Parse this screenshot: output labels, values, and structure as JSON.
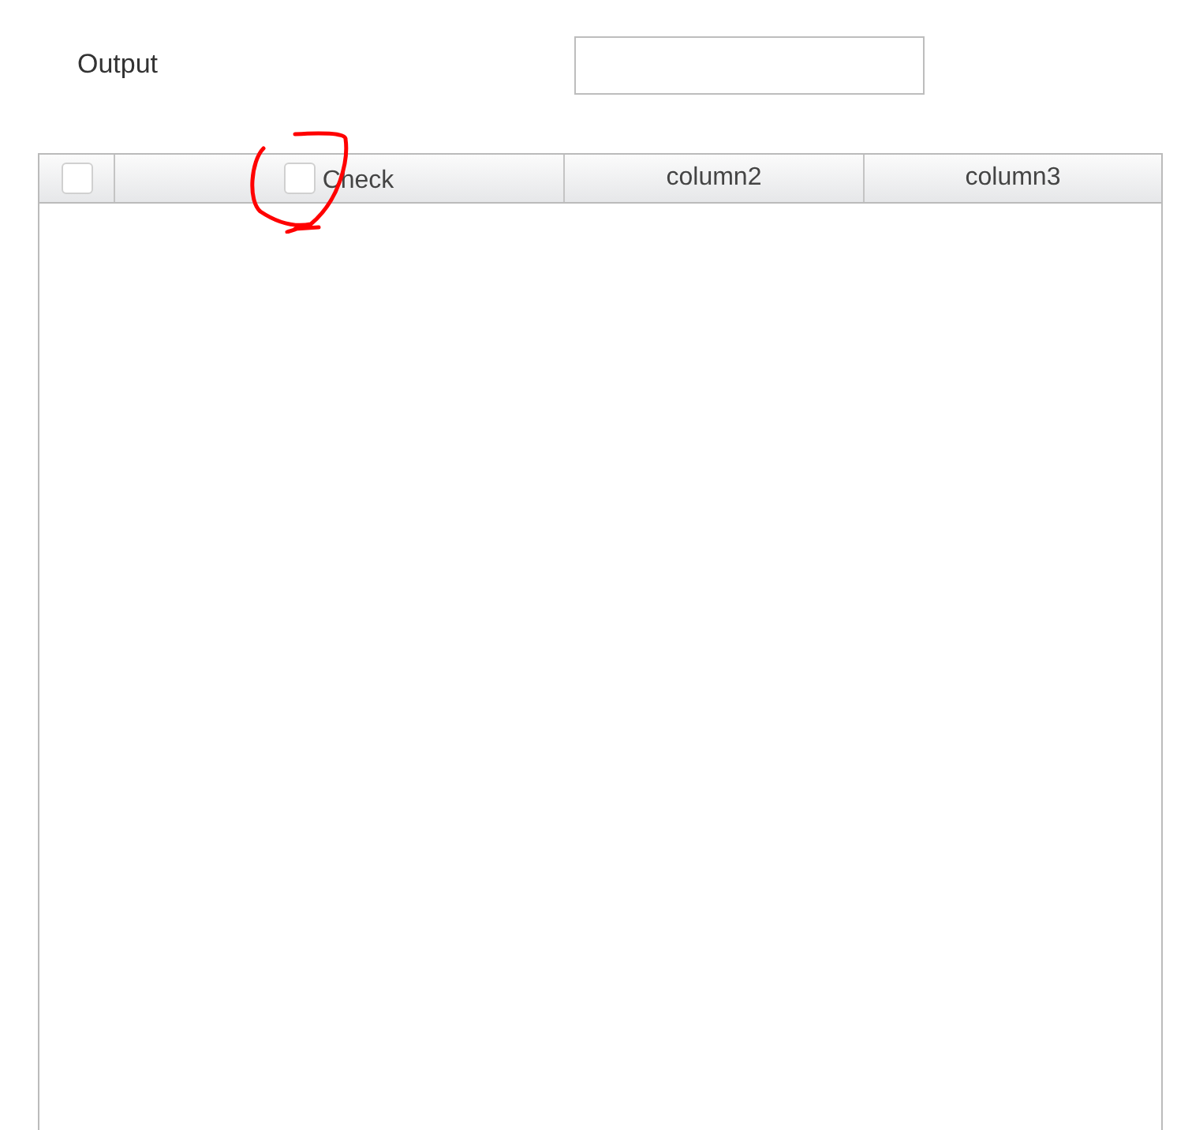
{
  "form": {
    "label": "Output"
  },
  "table": {
    "columns": [
      {
        "kind": "select",
        "checked": false
      },
      {
        "kind": "check",
        "label": "Check",
        "checked": false
      },
      {
        "kind": "text",
        "label": "column2"
      },
      {
        "kind": "text",
        "label": "column3"
      }
    ]
  }
}
